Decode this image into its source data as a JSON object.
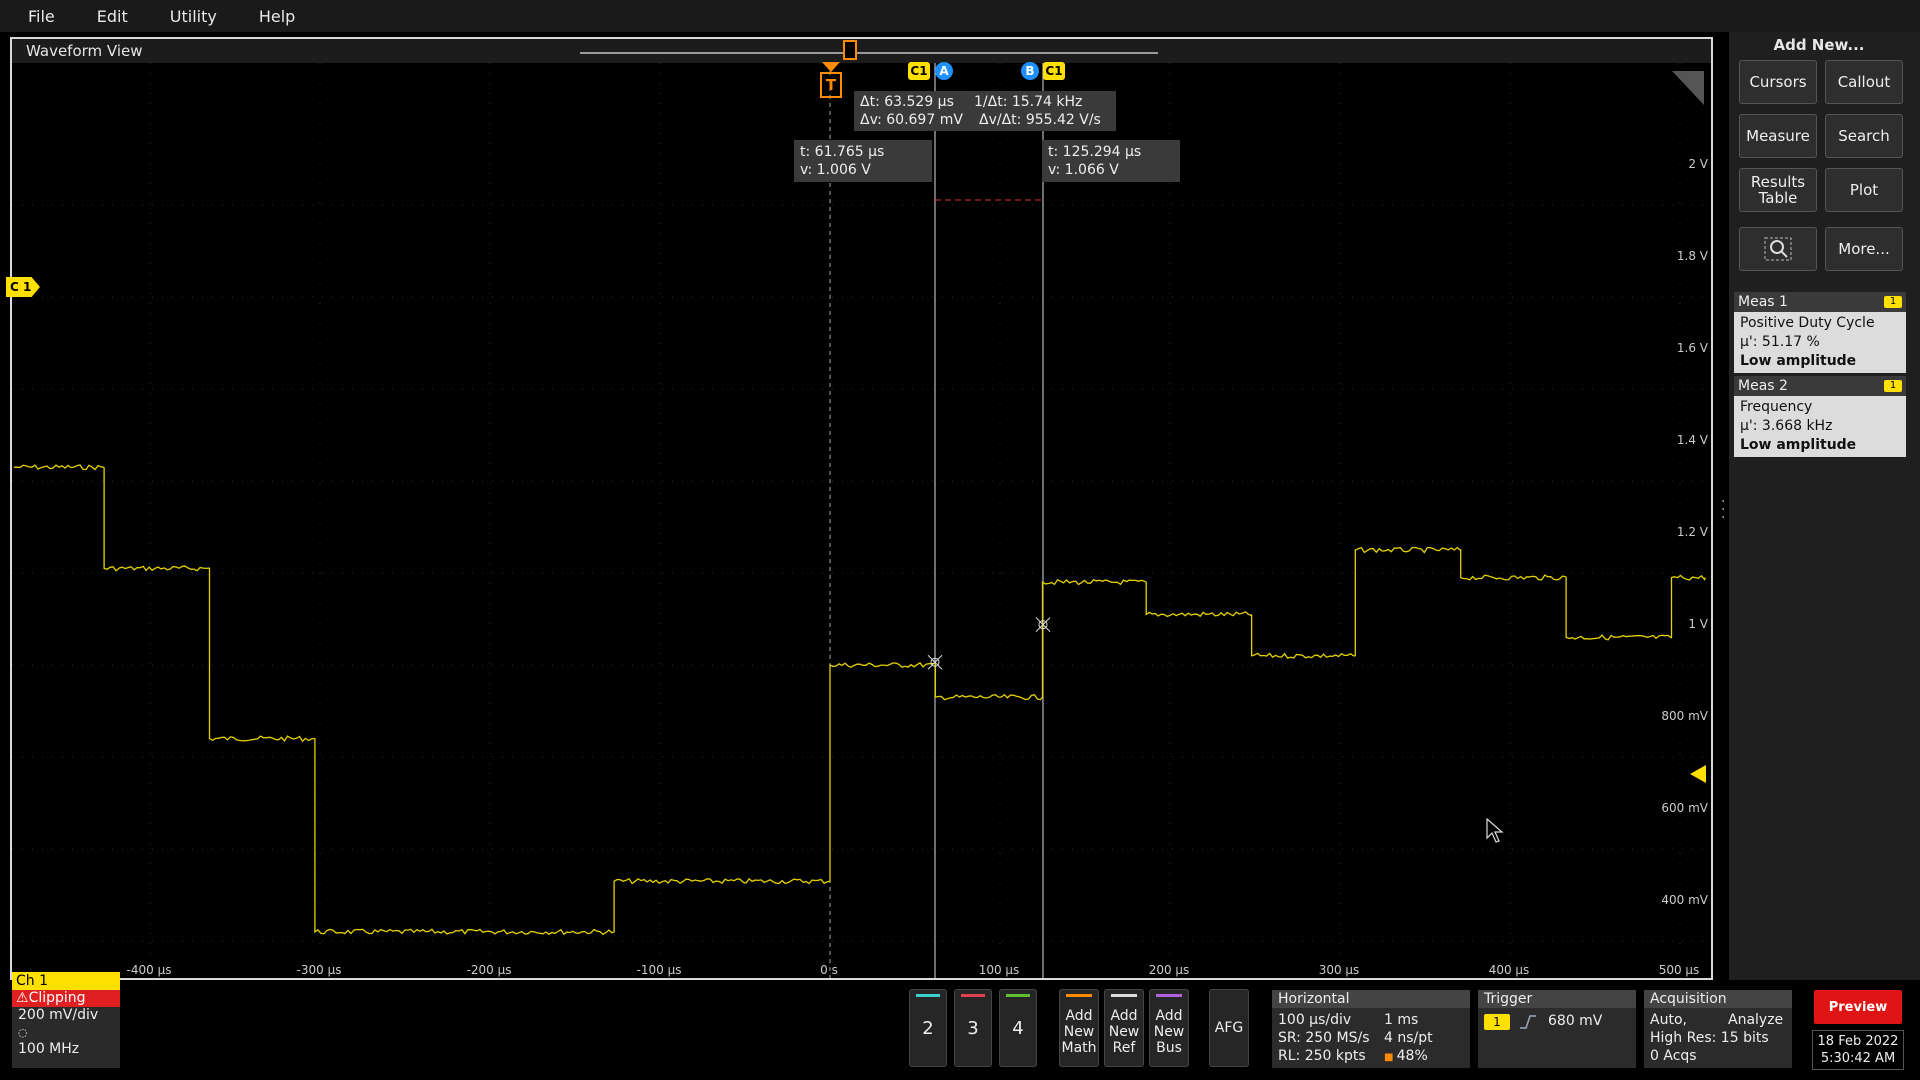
{
  "menu": [
    "File",
    "Edit",
    "Utility",
    "Help"
  ],
  "waveform_view": {
    "title": "Waveform View",
    "channel_marker": "C 1",
    "cursor_a_label": "A",
    "cursor_b_label": "B",
    "cursor_channel_label": "C1",
    "trigger_label": "T",
    "delta_readout": {
      "dt": "Δt: 63.529 µs",
      "dv": "Δv: 60.697 mV",
      "inv_dt": "1/Δt: 15.74 kHz",
      "dv_dt": "Δv/Δt: 955.42 V/s"
    },
    "cursor_a_readout": {
      "t": "t: 61.765 µs",
      "v": "v: 1.006 V"
    },
    "cursor_b_readout": {
      "t": "t: 125.294 µs",
      "v": "v: 1.066 V"
    },
    "y_axis_labels": [
      "2 V",
      "1.8 V",
      "1.6 V",
      "1.4 V",
      "1.2 V",
      "1 V",
      "800 mV",
      "600 mV",
      "400 mV"
    ],
    "x_axis_labels": [
      "-400 µs",
      "-300 µs",
      "-200 µs",
      "-100 µs",
      "0 s",
      "100 µs",
      "200 µs",
      "300 µs",
      "400 µs",
      "500 µs"
    ],
    "trace_color": "#e6d200",
    "waveform_levels": [
      {
        "t_start_us": -480,
        "t_end_us": -427,
        "v": 1.43
      },
      {
        "t_start_us": -427,
        "t_end_us": -365,
        "v": 1.21
      },
      {
        "t_start_us": -365,
        "t_end_us": -303,
        "v": 0.84
      },
      {
        "t_start_us": -303,
        "t_end_us": -127,
        "v": 0.42
      },
      {
        "t_start_us": -127,
        "t_end_us": 0,
        "v": 0.53
      },
      {
        "t_start_us": 0,
        "t_end_us": 62,
        "v": 1.0
      },
      {
        "t_start_us": 62,
        "t_end_us": 125,
        "v": 0.93
      },
      {
        "t_start_us": 125,
        "t_end_us": 186,
        "v": 1.18
      },
      {
        "t_start_us": 186,
        "t_end_us": 248,
        "v": 1.11
      },
      {
        "t_start_us": 248,
        "t_end_us": 309,
        "v": 1.02
      },
      {
        "t_start_us": 309,
        "t_end_us": 371,
        "v": 1.25
      },
      {
        "t_start_us": 371,
        "t_end_us": 433,
        "v": 1.19
      },
      {
        "t_start_us": 433,
        "t_end_us": 495,
        "v": 1.06
      },
      {
        "t_start_us": 495,
        "t_end_us": 515,
        "v": 1.19
      }
    ]
  },
  "side_panel": {
    "title": "Add New...",
    "buttons": [
      "Cursors",
      "Callout",
      "Measure",
      "Search",
      "Results Table",
      "Plot",
      "More..."
    ],
    "meas1": {
      "header": "Meas 1",
      "badge": "1",
      "name": "Positive Duty Cycle",
      "value": "µ': 51.17 %",
      "status": "Low amplitude"
    },
    "meas2": {
      "header": "Meas 2",
      "badge": "1",
      "name": "Frequency",
      "value": "µ': 3.668 kHz",
      "status": "Low amplitude"
    }
  },
  "bottom_bar": {
    "ch1": {
      "header": "Ch 1",
      "clipping": "Clipping",
      "scale": "200 mV/div",
      "bandwidth": "100 MHz"
    },
    "channels": [
      {
        "label": "2",
        "color": "#3ad0d0"
      },
      {
        "label": "3",
        "color": "#e04050"
      },
      {
        "label": "4",
        "color": "#60c030"
      }
    ],
    "add_math": "Add New Math",
    "add_ref": "Add New Ref",
    "add_bus": "Add New Bus",
    "afg": "AFG",
    "horizontal": {
      "title": "Horizontal",
      "scale": "100 µs/div",
      "duration": "1 ms",
      "sr": "SR: 250 MS/s",
      "pt": "4 ns/pt",
      "rl": "RL: 250 kpts",
      "pos": "48%"
    },
    "trigger": {
      "title": "Trigger",
      "source": "1",
      "level": "680 mV"
    },
    "acquisition": {
      "title": "Acquisition",
      "mode": "Auto,",
      "analyze": "Analyze",
      "hires": "High Res: 15 bits",
      "acqs": "0 Acqs"
    },
    "preview": "Preview",
    "date": "18 Feb 2022",
    "time": "5:30:42 AM"
  }
}
